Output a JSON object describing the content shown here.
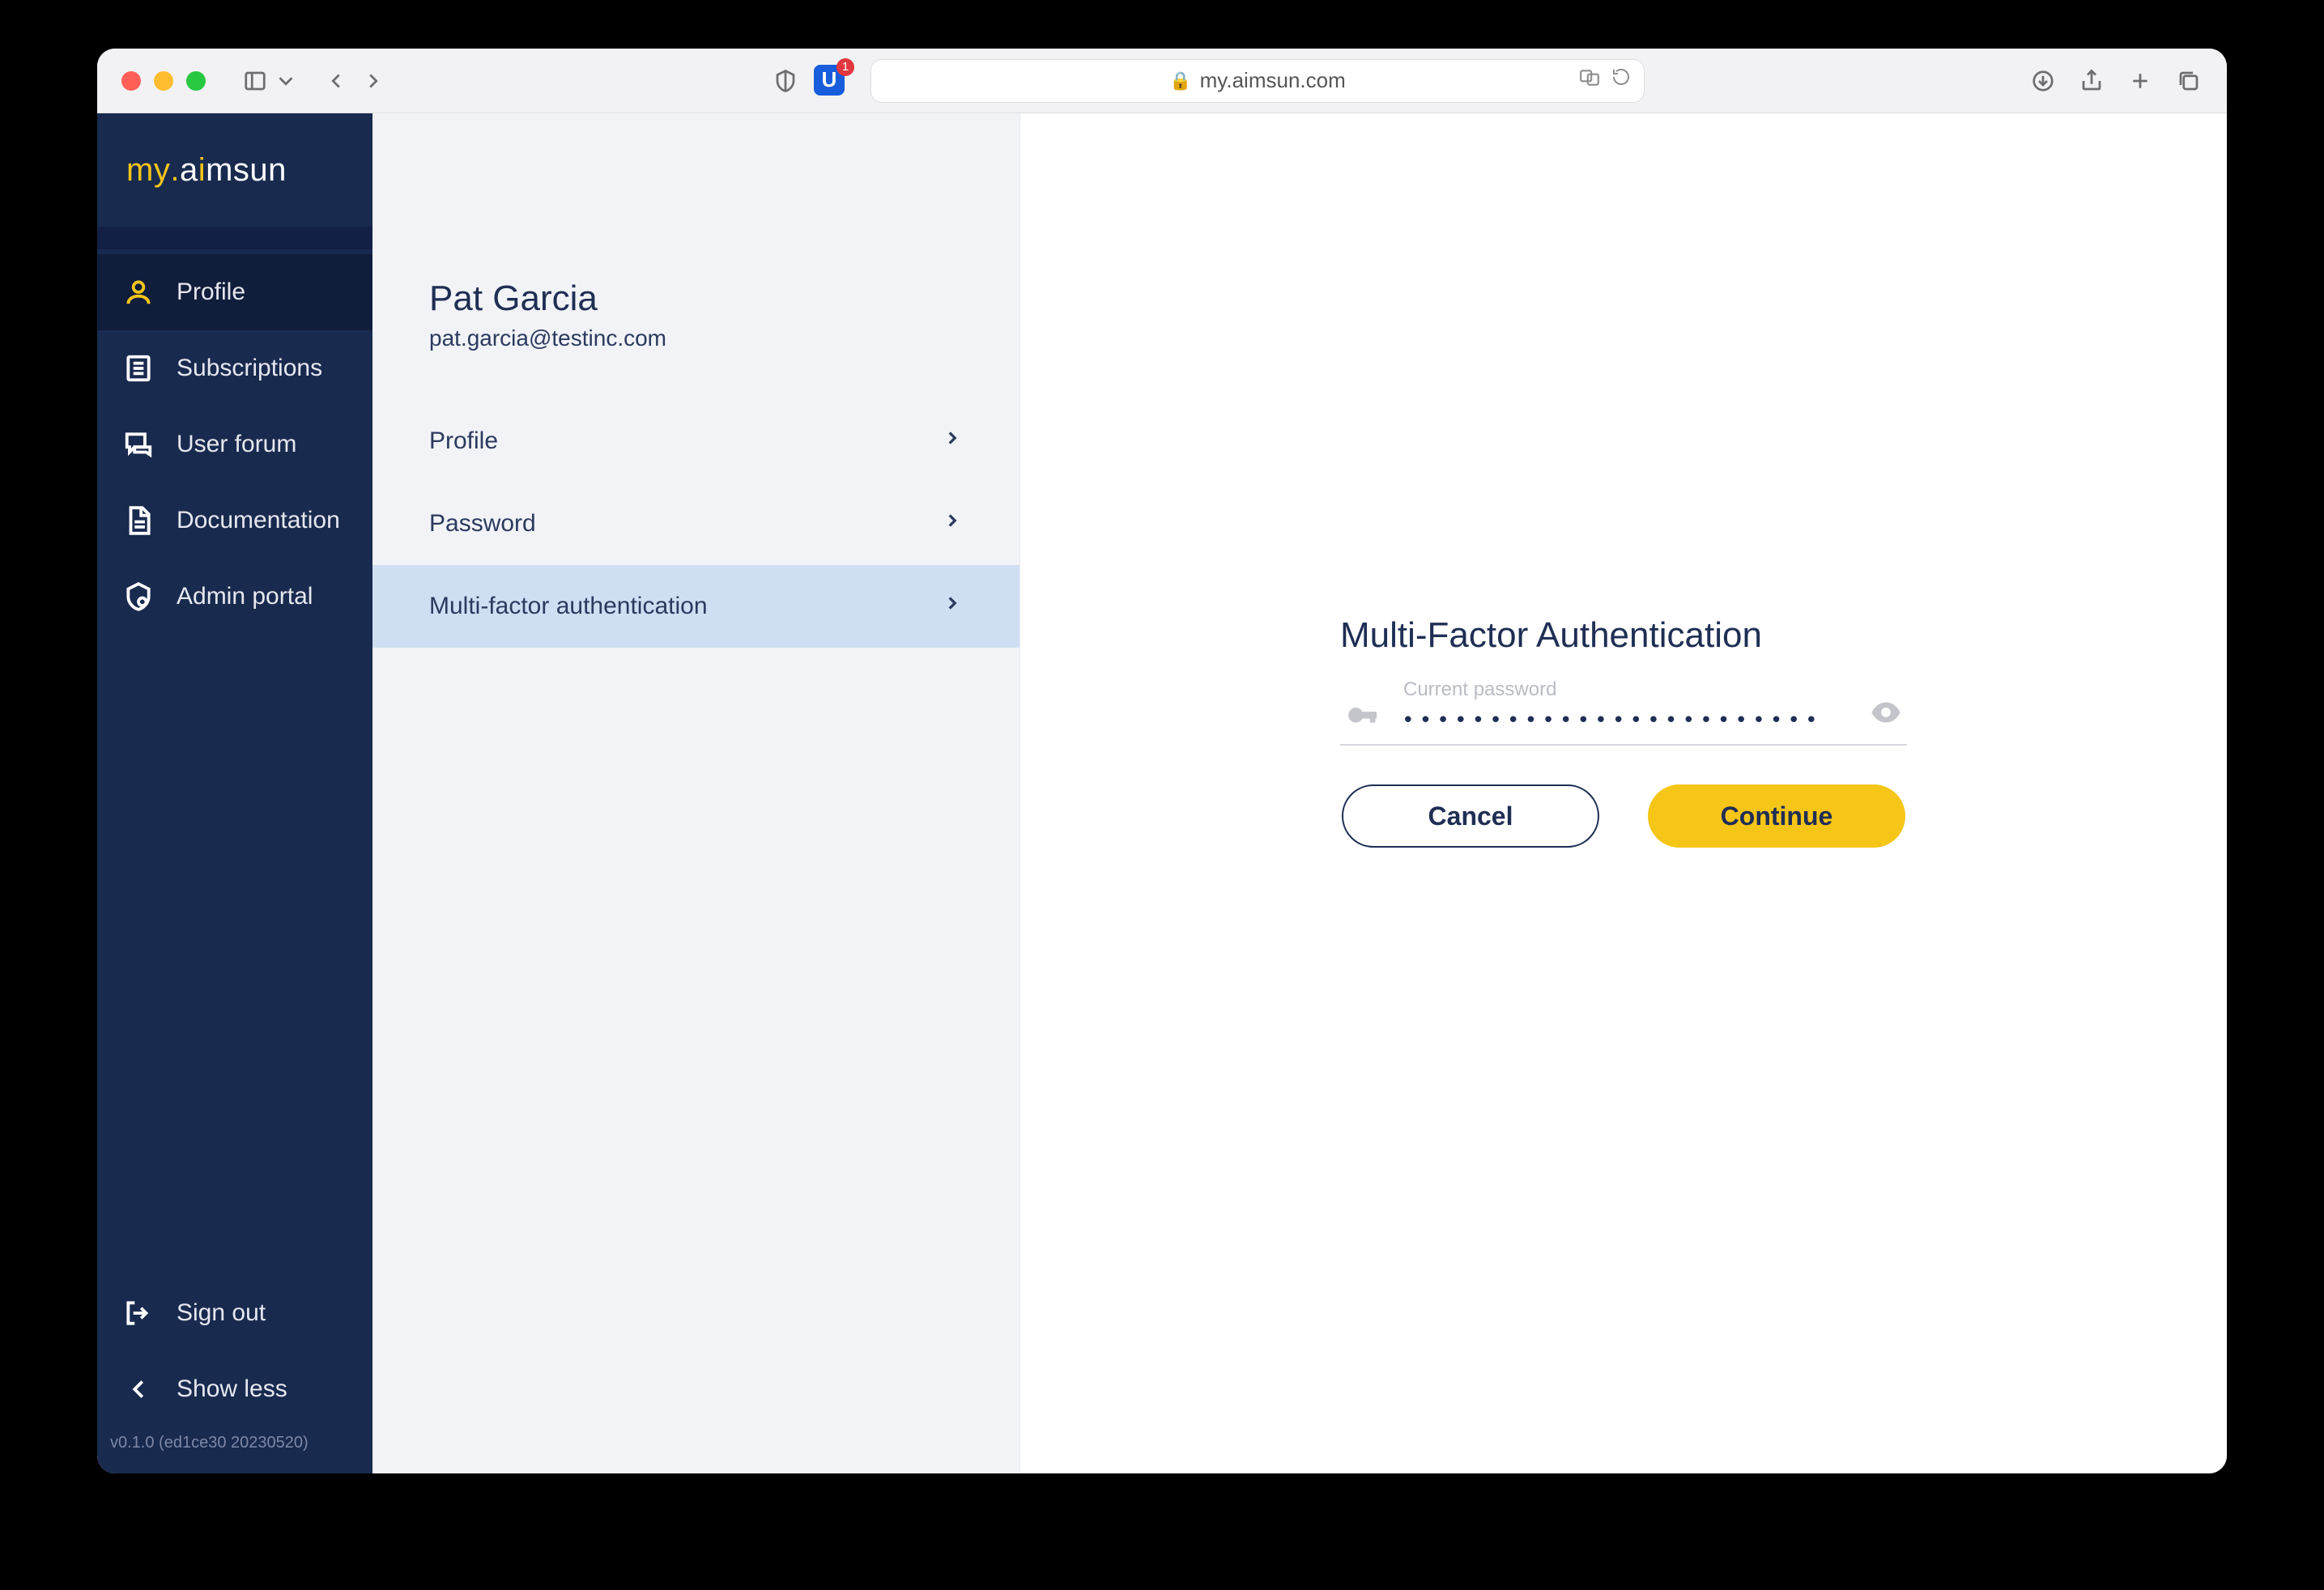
{
  "browser": {
    "url": "my.aimsun.com",
    "badge_count": "1"
  },
  "logo": {
    "my": "my",
    "dot": ".",
    "aimsun": "aimsun"
  },
  "sidebar": {
    "items": [
      {
        "label": "Profile"
      },
      {
        "label": "Subscriptions"
      },
      {
        "label": "User forum"
      },
      {
        "label": "Documentation"
      },
      {
        "label": "Admin portal"
      }
    ],
    "bottom": [
      {
        "label": "Sign out"
      },
      {
        "label": "Show less"
      }
    ],
    "version": "v0.1.0 (ed1ce30 20230520)"
  },
  "user": {
    "name": "Pat Garcia",
    "email": "pat.garcia@testinc.com"
  },
  "settings": {
    "items": [
      {
        "label": "Profile"
      },
      {
        "label": "Password"
      },
      {
        "label": "Multi-factor authentication"
      }
    ]
  },
  "mfa": {
    "title": "Multi-Factor Authentication",
    "field_label": "Current password",
    "password_mask": "••••••••••••••••••••••••",
    "cancel": "Cancel",
    "continue": "Continue"
  }
}
